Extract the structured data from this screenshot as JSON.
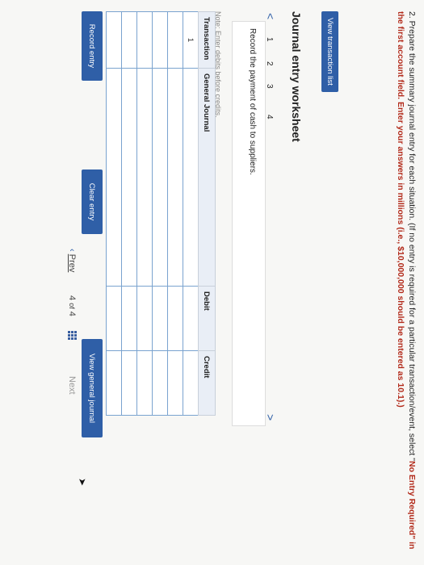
{
  "instructions": {
    "text_before": "2. Prepare the summary journal entry for each situation. (If no entry is required for a particular transaction/event, select \"",
    "highlight": "No Entry Required\" in the first account field. Enter your answers in millions (i.e., $10,000,000 should be entered as 10.1).)"
  },
  "view_transaction_list": "View transaction list",
  "worksheet": {
    "title": "Journal entry worksheet",
    "prev_arrow": "<",
    "next_arrow": ">",
    "tabs": [
      "1",
      "2",
      "3",
      "4"
    ],
    "active_tab": "1",
    "description": "Record the payment of cash to suppliers.",
    "note": "Note: Enter debits before credits."
  },
  "journal": {
    "headers": {
      "transaction": "Transaction",
      "general_journal": "General Journal",
      "debit": "Debit",
      "credit": "Credit"
    },
    "rows": [
      {
        "transaction": "1"
      },
      {
        "transaction": ""
      },
      {
        "transaction": ""
      },
      {
        "transaction": ""
      },
      {
        "transaction": ""
      },
      {
        "transaction": ""
      }
    ]
  },
  "buttons": {
    "record_entry": "Record entry",
    "clear_entry": "Clear entry",
    "view_general_journal": "View general journal"
  },
  "pagination": {
    "prev": "Prev",
    "current": "4",
    "of": "of",
    "total": "4",
    "next": "Next"
  },
  "colors": {
    "accent": "#2f5fa7",
    "instruction_highlight": "#b22a1a"
  }
}
